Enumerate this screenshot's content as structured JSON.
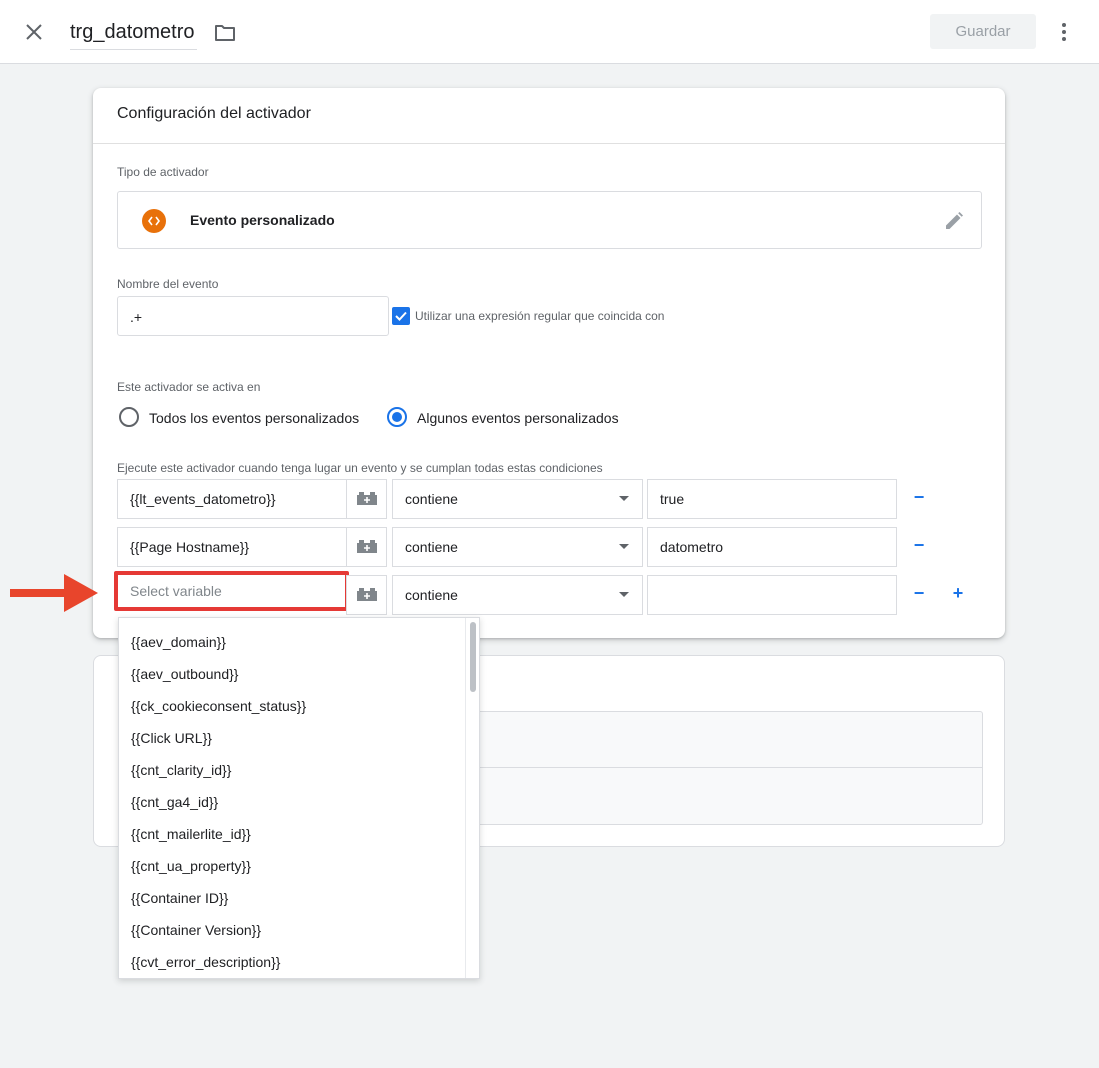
{
  "header": {
    "title": "trg_datometro",
    "save_label": "Guardar"
  },
  "card": {
    "title": "Configuración del activador",
    "trigger_type_label": "Tipo de activador",
    "trigger_type_name": "Evento personalizado",
    "event_name_label": "Nombre del evento",
    "event_name_value": ".+",
    "regex_checkbox_label": "Utilizar una expresión regular que coincida con",
    "regex_checked": true,
    "fires_on_label": "Este activador se activa en",
    "radio_all_label": "Todos los eventos personalizados",
    "radio_some_label": "Algunos eventos personalizados",
    "selected_radio": "some",
    "conditions_label": "Ejecute este activador cuando tenga lugar un evento y se cumplan todas estas condiciones",
    "conditions": [
      {
        "variable": "{{lt_events_datometro}}",
        "operator": "contiene",
        "value": "true"
      },
      {
        "variable": "{{Page Hostname}}",
        "operator": "contiene",
        "value": "datometro"
      },
      {
        "variable": "",
        "variable_placeholder": "Select variable",
        "operator": "contiene",
        "value": ""
      }
    ],
    "minus_symbol": "−",
    "plus_symbol": "+"
  },
  "dropdown": {
    "items": [
      "{{aev_domain}}",
      "{{aev_outbound}}",
      "{{ck_cookieconsent_status}}",
      "{{Click URL}}",
      "{{cnt_clarity_id}}",
      "{{cnt_ga4_id}}",
      "{{cnt_mailerlite_id}}",
      "{{cnt_ua_property}}",
      "{{Container ID}}",
      "{{Container Version}}",
      "{{cvt_error_description}}"
    ]
  },
  "colors": {
    "accent": "#1a73e8",
    "trigger_icon": "#e8710a",
    "highlight": "#e53935",
    "arrow": "#e8452c"
  },
  "icons": {
    "close": "close-icon",
    "folder": "folder-icon",
    "more": "more-vert-icon",
    "trigger_type": "custom-event-icon",
    "edit": "pencil-icon",
    "variable_picker": "variable-brick-icon",
    "annotation": "red-arrow-icon"
  }
}
